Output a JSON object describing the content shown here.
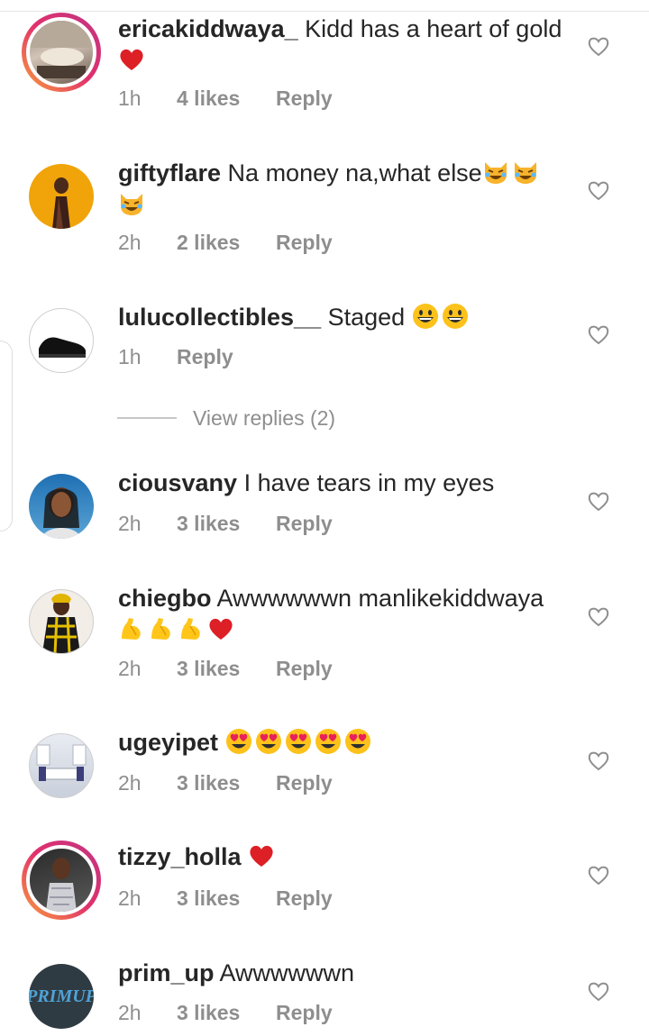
{
  "comments": [
    {
      "username": "ericakiddwaya_",
      "text": "Kidd has a heart of gold",
      "emojis_inline": [],
      "emojis_line2": [
        "red-heart"
      ],
      "time": "1h",
      "likes": "4 likes",
      "reply": "Reply"
    },
    {
      "username": "giftyflare",
      "text": "Na money na,what else",
      "emojis_inline": [
        "cat-joy",
        "cat-joy"
      ],
      "emojis_line2": [
        "cat-joy"
      ],
      "time": "2h",
      "likes": "2 likes",
      "reply": "Reply"
    },
    {
      "username": "lulucollectibles__",
      "text": "Staged",
      "emojis_inline": [
        "grinning",
        "grinning"
      ],
      "emojis_line2": [],
      "time": "1h",
      "likes": "",
      "reply": "Reply"
    },
    {
      "username": "ciousvany",
      "text": "I have tears in my eyes",
      "emojis_inline": [],
      "emojis_line2": [],
      "time": "2h",
      "likes": "3 likes",
      "reply": "Reply"
    },
    {
      "username": "chiegbo",
      "text": "Awwwwwwn manlikekiddwaya",
      "emojis_inline": [],
      "emojis_line2": [
        "flexed-biceps",
        "flexed-biceps",
        "flexed-biceps",
        "red-heart"
      ],
      "time": "2h",
      "likes": "3 likes",
      "reply": "Reply"
    },
    {
      "username": "ugeyipet",
      "text": "",
      "emojis_inline": [
        "heart-eyes",
        "heart-eyes",
        "heart-eyes",
        "heart-eyes",
        "heart-eyes"
      ],
      "emojis_line2": [],
      "time": "2h",
      "likes": "3 likes",
      "reply": "Reply"
    },
    {
      "username": "tizzy_holla",
      "text": "",
      "emojis_inline": [
        "red-heart"
      ],
      "emojis_line2": [],
      "time": "2h",
      "likes": "3 likes",
      "reply": "Reply"
    },
    {
      "username": "prim_up",
      "text": "Awwwwwwn",
      "emojis_inline": [],
      "emojis_line2": [],
      "time": "2h",
      "likes": "3 likes",
      "reply": "Reply"
    }
  ],
  "view_replies": "View replies (2)",
  "avatar_text": {
    "prim_up": "PRIMUP"
  },
  "colors": {
    "meta": "#8e8e8e",
    "text": "#262626",
    "story_ring": "#e1306c"
  }
}
